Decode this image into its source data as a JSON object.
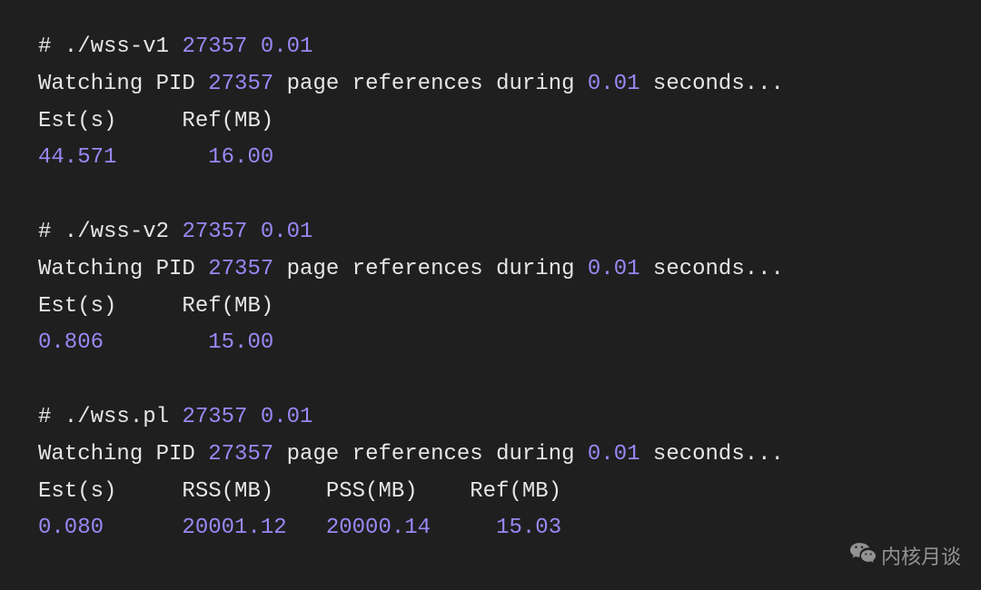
{
  "blocks": [
    {
      "cmd_prefix": "# ./wss-v1 ",
      "cmd_args": "27357 0.01",
      "watch_prefix": "Watching PID ",
      "watch_pid": "27357",
      "watch_mid": " page references during ",
      "watch_dur": "0.01",
      "watch_suffix": " seconds...",
      "header": "Est(s)     Ref(MB)",
      "data_row": "44.571       16.00"
    },
    {
      "cmd_prefix": "# ./wss-v2 ",
      "cmd_args": "27357 0.01",
      "watch_prefix": "Watching PID ",
      "watch_pid": "27357",
      "watch_mid": " page references during ",
      "watch_dur": "0.01",
      "watch_suffix": " seconds...",
      "header": "Est(s)     Ref(MB)",
      "data_row": "0.806        15.00"
    },
    {
      "cmd_prefix": "# ./wss.pl ",
      "cmd_args": "27357 0.01",
      "watch_prefix": "Watching PID ",
      "watch_pid": "27357",
      "watch_mid": " page references during ",
      "watch_dur": "0.01",
      "watch_suffix": " seconds...",
      "header": "Est(s)     RSS(MB)    PSS(MB)    Ref(MB)",
      "data_row": "0.080      20001.12   20000.14     15.03"
    }
  ],
  "watermark": {
    "text": "内核月谈"
  }
}
